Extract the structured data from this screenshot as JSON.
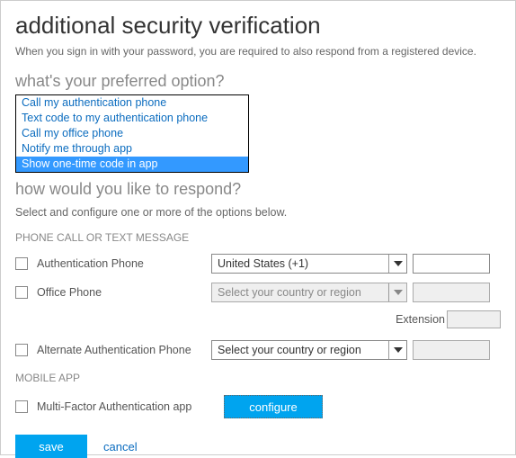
{
  "title": "additional security verification",
  "subtitle": "When you sign in with your password, you are required to also respond from a registered device.",
  "preferred": {
    "heading": "what's your preferred option?",
    "options": [
      "Call my authentication phone",
      "Text code to my authentication phone",
      "Call my office phone",
      "Notify me through app",
      "Show one-time code in app"
    ],
    "selected_index": 4
  },
  "respond": {
    "heading": "how would you like to respond?",
    "help": "Select and configure one or more of the options below."
  },
  "phone_section": {
    "label": "PHONE CALL OR TEXT MESSAGE",
    "rows": {
      "auth_phone": {
        "label": "Authentication Phone",
        "select_value": "United States (+1)",
        "select_disabled": false,
        "input_disabled": false
      },
      "office_phone": {
        "label": "Office Phone",
        "select_value": "Select your country or region",
        "select_disabled": true,
        "input_disabled": true
      },
      "extension_label": "Extension",
      "alt_phone": {
        "label": "Alternate Authentication Phone",
        "select_value": "Select your country or region",
        "select_disabled": false,
        "input_disabled": true
      }
    }
  },
  "mobile_section": {
    "label": "MOBILE APP",
    "mfa_label": "Multi-Factor Authentication app",
    "configure_label": "configure"
  },
  "footer": {
    "save": "save",
    "cancel": "cancel"
  }
}
